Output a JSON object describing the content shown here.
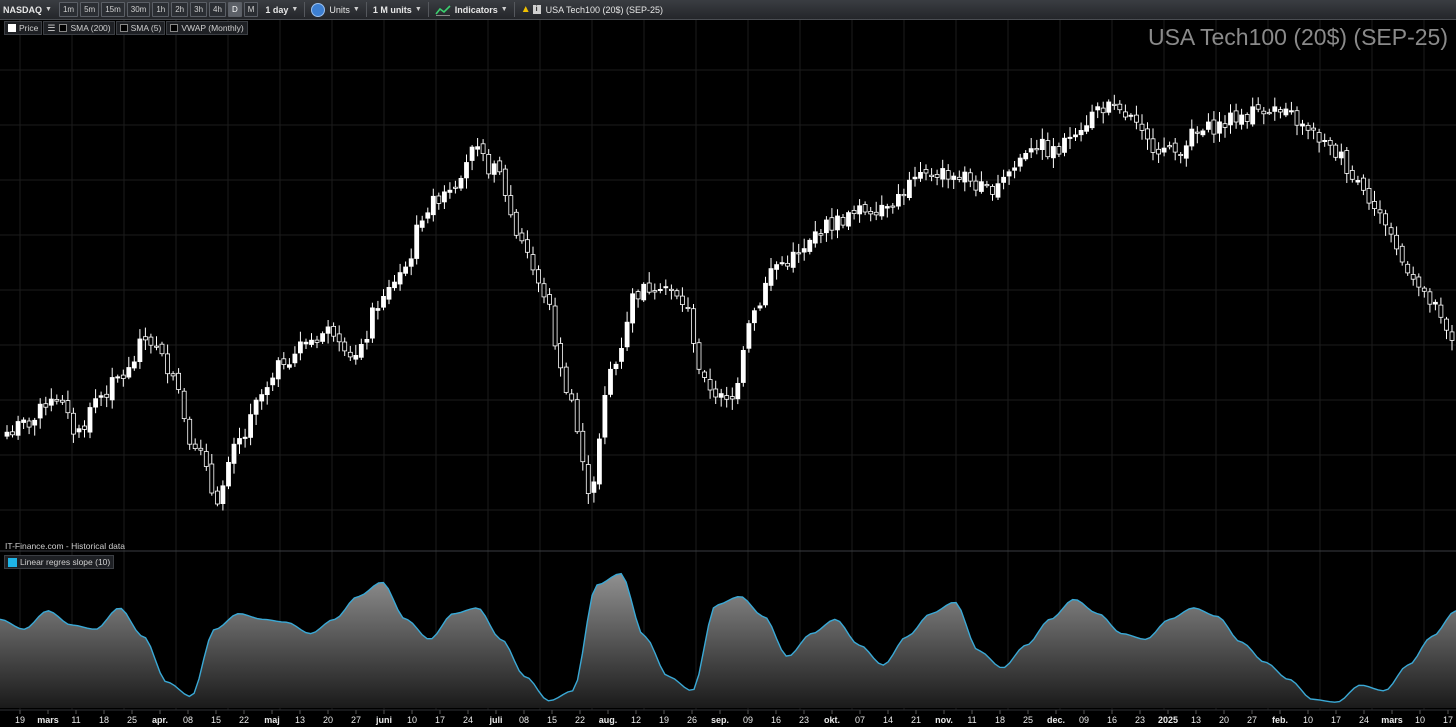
{
  "toolbar": {
    "exchange": "NASDAQ",
    "timeframes": [
      "1m",
      "5m",
      "15m",
      "30m",
      "1h",
      "2h",
      "3h",
      "4h",
      "D",
      "M"
    ],
    "active_timeframe": "D",
    "period": "1 day",
    "units_label": "Units",
    "size_label": "1 M units",
    "indicators_label": "Indicators",
    "instrument_label": "USA Tech100 (20$) (SEP-25)"
  },
  "price_legend": {
    "items": [
      "Price",
      "SMA (200)",
      "SMA (5)",
      "VWAP (Monthly)"
    ]
  },
  "chart_title": "USA Tech100 (20$) (SEP-25)",
  "credit": "IT-Finance.com - Historical data",
  "indicator_legend": "Linear regres slope (10)",
  "colors": {
    "candle": "#ffffff",
    "indicator_line": "#3aa9d6",
    "indicator_fill_top": "#8c8c8c",
    "indicator_fill_bottom": "#1a1a1a",
    "grid": "#1c1c1c"
  },
  "chart_data": {
    "type": "candlestick",
    "axis_ticks": [
      {
        "label": "19",
        "bold": false
      },
      {
        "label": "mars",
        "bold": true
      },
      {
        "label": "11",
        "bold": false
      },
      {
        "label": "18",
        "bold": false
      },
      {
        "label": "25",
        "bold": false
      },
      {
        "label": "apr.",
        "bold": true
      },
      {
        "label": "08",
        "bold": false
      },
      {
        "label": "15",
        "bold": false
      },
      {
        "label": "22",
        "bold": false
      },
      {
        "label": "maj",
        "bold": true
      },
      {
        "label": "13",
        "bold": false
      },
      {
        "label": "20",
        "bold": false
      },
      {
        "label": "27",
        "bold": false
      },
      {
        "label": "juni",
        "bold": true
      },
      {
        "label": "10",
        "bold": false
      },
      {
        "label": "17",
        "bold": false
      },
      {
        "label": "24",
        "bold": false
      },
      {
        "label": "juli",
        "bold": true
      },
      {
        "label": "08",
        "bold": false
      },
      {
        "label": "15",
        "bold": false
      },
      {
        "label": "22",
        "bold": false
      },
      {
        "label": "aug.",
        "bold": true
      },
      {
        "label": "12",
        "bold": false
      },
      {
        "label": "19",
        "bold": false
      },
      {
        "label": "26",
        "bold": false
      },
      {
        "label": "sep.",
        "bold": true
      },
      {
        "label": "09",
        "bold": false
      },
      {
        "label": "16",
        "bold": false
      },
      {
        "label": "23",
        "bold": false
      },
      {
        "label": "okt.",
        "bold": true
      },
      {
        "label": "07",
        "bold": false
      },
      {
        "label": "14",
        "bold": false
      },
      {
        "label": "21",
        "bold": false
      },
      {
        "label": "nov.",
        "bold": true
      },
      {
        "label": "11",
        "bold": false
      },
      {
        "label": "18",
        "bold": false
      },
      {
        "label": "25",
        "bold": false
      },
      {
        "label": "dec.",
        "bold": true
      },
      {
        "label": "09",
        "bold": false
      },
      {
        "label": "16",
        "bold": false
      },
      {
        "label": "23",
        "bold": false
      },
      {
        "label": "2025",
        "bold": true
      },
      {
        "label": "13",
        "bold": false
      },
      {
        "label": "20",
        "bold": false
      },
      {
        "label": "27",
        "bold": false
      },
      {
        "label": "feb.",
        "bold": true
      },
      {
        "label": "10",
        "bold": false
      },
      {
        "label": "17",
        "bold": false
      },
      {
        "label": "24",
        "bold": false
      },
      {
        "label": "mars",
        "bold": true
      },
      {
        "label": "10",
        "bold": false
      },
      {
        "label": "17",
        "bold": false
      }
    ],
    "price_level_keypoints": [
      0.2,
      0.22,
      0.28,
      0.2,
      0.28,
      0.32,
      0.4,
      0.34,
      0.18,
      0.06,
      0.18,
      0.28,
      0.36,
      0.4,
      0.42,
      0.36,
      0.48,
      0.55,
      0.68,
      0.73,
      0.8,
      0.76,
      0.62,
      0.5,
      0.3,
      0.08,
      0.34,
      0.5,
      0.52,
      0.48,
      0.3,
      0.26,
      0.46,
      0.56,
      0.58,
      0.64,
      0.66,
      0.68,
      0.7,
      0.74,
      0.76,
      0.75,
      0.72,
      0.76,
      0.82,
      0.8,
      0.86,
      0.9,
      0.88,
      0.82,
      0.8,
      0.84,
      0.86,
      0.88,
      0.9,
      0.88,
      0.84,
      0.8,
      0.74,
      0.66,
      0.56,
      0.48,
      0.4
    ],
    "slope_keypoints": [
      0.62,
      0.55,
      0.68,
      0.58,
      0.55,
      0.7,
      0.5,
      0.18,
      0.08,
      0.55,
      0.66,
      0.62,
      0.6,
      0.52,
      0.62,
      0.78,
      0.88,
      0.62,
      0.48,
      0.66,
      0.7,
      0.48,
      0.22,
      0.05,
      0.12,
      0.86,
      0.94,
      0.5,
      0.22,
      0.12,
      0.72,
      0.78,
      0.64,
      0.36,
      0.52,
      0.62,
      0.44,
      0.3,
      0.5,
      0.66,
      0.74,
      0.4,
      0.28,
      0.44,
      0.62,
      0.76,
      0.66,
      0.52,
      0.48,
      0.62,
      0.7,
      0.64,
      0.46,
      0.32,
      0.2,
      0.06,
      0.04,
      0.16,
      0.12,
      0.3,
      0.5,
      0.68
    ]
  }
}
